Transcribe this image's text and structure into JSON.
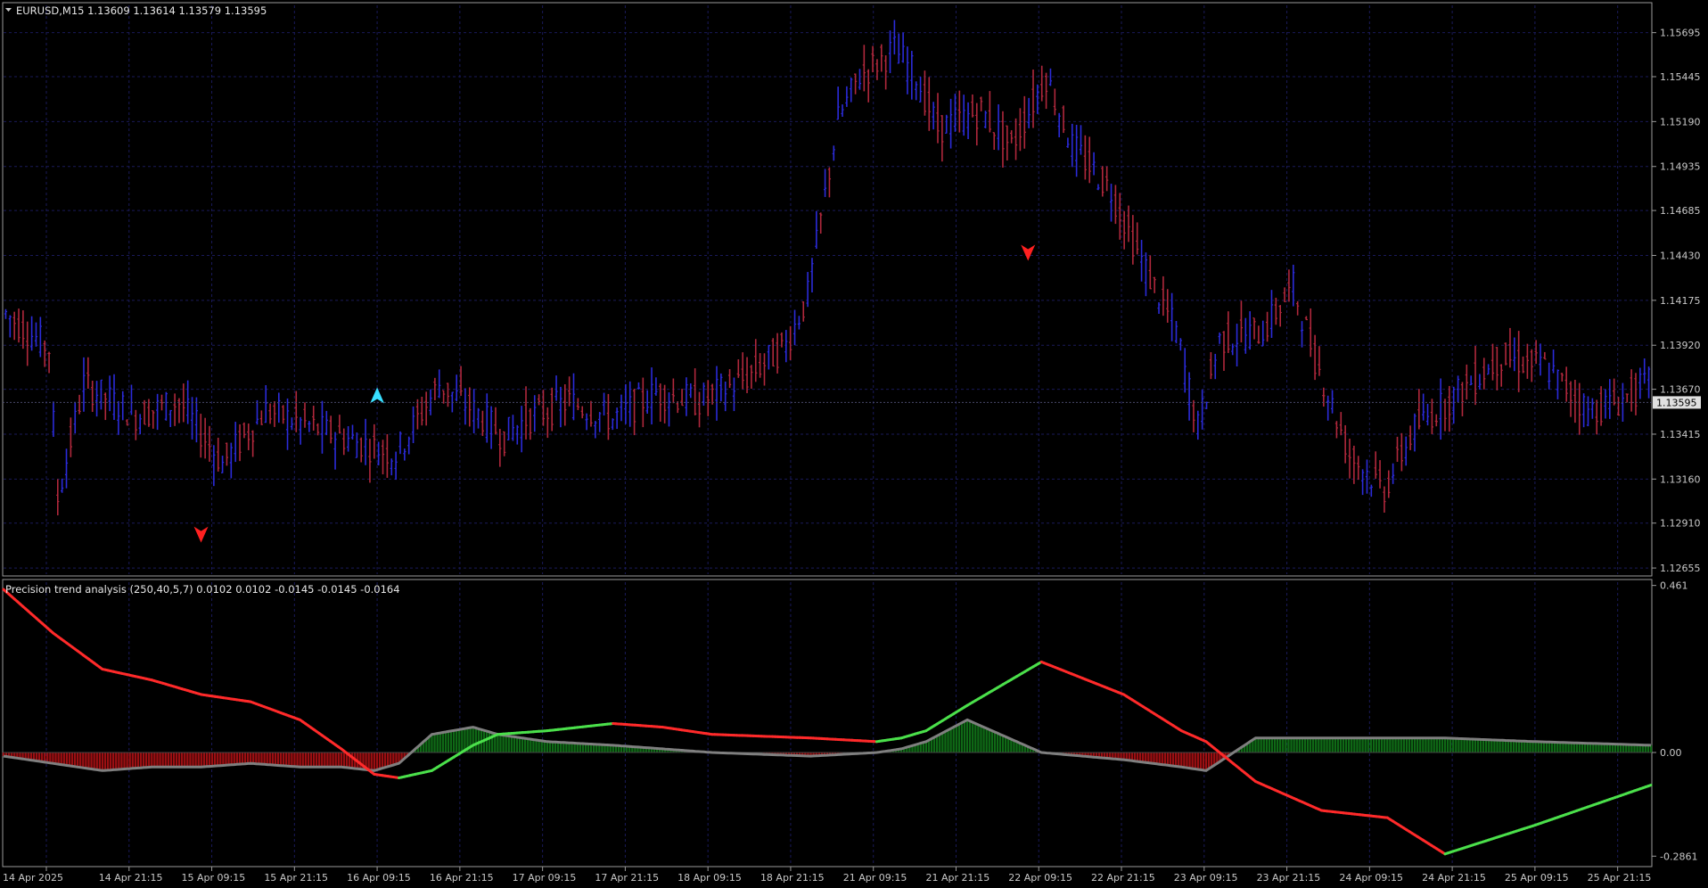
{
  "window": {
    "symbol_title": "EURUSD,M15  1.13609 1.13614 1.13579 1.13595",
    "indicator_title": "Precision trend analysis (250,40,5,7) 0.0102 0.0102 -0.0145 -0.0145 -0.0164"
  },
  "colors": {
    "background": "#000000",
    "grid": "#1a1a5a",
    "frame": "#9a9a9a",
    "bar_up": "#2b2bd9",
    "bar_down": "#b0283c",
    "trend_up": "#4be04b",
    "trend_down": "#ff2a2a",
    "hist_pos": "#0f6a16",
    "hist_neg": "#9c0f12",
    "grey_line": "#7f7f7f",
    "current_price_box": "#e0e0e0"
  },
  "chart_data": [
    {
      "type": "line",
      "title": "EURUSD,M15  1.13609 1.13614 1.13579 1.13595",
      "description_style": "price bars",
      "current_price": "1.13595",
      "y_ticks": [
        "1.15695",
        "1.15445",
        "1.15190",
        "1.14935",
        "1.14685",
        "1.14430",
        "1.14175",
        "1.13920",
        "1.13670",
        "1.13415",
        "1.13160",
        "1.12910",
        "1.12655"
      ],
      "ylim": [
        1.1262,
        1.1585
      ],
      "x_count": 380,
      "x": [
        0,
        15,
        30,
        45,
        50,
        60,
        75,
        95,
        110,
        120,
        135,
        150,
        165,
        170,
        180,
        195,
        210,
        225,
        235,
        250,
        265,
        280,
        300,
        320,
        340,
        360,
        380
      ],
      "y": [
        1.141,
        1.1385,
        1.135,
        1.13,
        1.134,
        1.1345,
        1.1358,
        1.1325,
        1.1345,
        1.1338,
        1.1365,
        1.1352,
        1.131,
        1.1332,
        1.1322,
        1.1353,
        1.1368,
        1.136,
        1.134,
        1.137,
        1.1352,
        1.1363,
        1.135,
        1.1335,
        1.132,
        1.138,
        1.1395
      ],
      "signals": [
        {
          "type": "sell",
          "label": "red arrow down",
          "x_label": "15 Apr 09:15"
        },
        {
          "type": "buy",
          "label": "cyan arrow up",
          "x_label": "16 Apr 09:15"
        },
        {
          "type": "sell",
          "label": "red arrow down",
          "x_label": "22 Apr 09:15"
        }
      ]
    },
    {
      "type": "line",
      "title": "Precision trend analysis (250,40,5,7) 0.0102 0.0102 -0.0145 -0.0145 -0.0164",
      "y_ticks": [
        "0.461",
        "0.00",
        "-0.2861"
      ],
      "ylim": [
        -0.31,
        0.47
      ],
      "series": [
        {
          "name": "Trend",
          "x_frac": [
            0,
            0.03,
            0.06,
            0.09,
            0.12,
            0.15,
            0.18,
            0.205,
            0.225,
            0.24,
            0.26,
            0.285,
            0.3,
            0.33,
            0.37,
            0.4,
            0.43,
            0.49,
            0.53,
            0.545,
            0.56,
            0.585,
            0.63,
            0.68,
            0.715,
            0.73,
            0.76,
            0.8,
            0.84,
            0.875,
            0.93,
            1.0
          ],
          "values": [
            0.45,
            0.33,
            0.23,
            0.2,
            0.16,
            0.14,
            0.09,
            0.01,
            -0.06,
            -0.07,
            -0.05,
            0.02,
            0.05,
            0.06,
            0.08,
            0.07,
            0.05,
            0.04,
            0.03,
            0.04,
            0.06,
            0.13,
            0.25,
            0.16,
            0.06,
            0.03,
            -0.08,
            -0.16,
            -0.18,
            -0.28,
            -0.2,
            -0.09
          ]
        },
        {
          "name": "Histogram",
          "x_frac": [
            0,
            0.03,
            0.06,
            0.09,
            0.12,
            0.15,
            0.18,
            0.205,
            0.225,
            0.24,
            0.26,
            0.285,
            0.3,
            0.33,
            0.37,
            0.4,
            0.43,
            0.49,
            0.53,
            0.545,
            0.56,
            0.585,
            0.63,
            0.68,
            0.715,
            0.73,
            0.76,
            0.8,
            0.84,
            0.875,
            0.93,
            1.0
          ],
          "values": [
            -0.01,
            -0.03,
            -0.05,
            -0.04,
            -0.04,
            -0.03,
            -0.04,
            -0.04,
            -0.05,
            -0.03,
            0.05,
            0.07,
            0.05,
            0.03,
            0.02,
            0.01,
            0.0,
            -0.01,
            0.0,
            0.01,
            0.03,
            0.09,
            0.0,
            -0.02,
            -0.04,
            -0.05,
            0.04,
            0.04,
            0.04,
            0.04,
            0.03,
            0.02
          ]
        }
      ]
    }
  ],
  "x_axis_labels": [
    "14 Apr 2025",
    "14 Apr 21:15",
    "15 Apr 09:15",
    "15 Apr 21:15",
    "16 Apr 09:15",
    "16 Apr 21:15",
    "17 Apr 09:15",
    "17 Apr 21:15",
    "18 Apr 09:15",
    "18 Apr 21:15",
    "21 Apr 09:15",
    "21 Apr 21:15",
    "22 Apr 09:15",
    "22 Apr 21:15",
    "23 Apr 09:15",
    "23 Apr 21:15",
    "24 Apr 09:15",
    "24 Apr 21:15",
    "25 Apr 09:15",
    "25 Apr 21:15"
  ]
}
